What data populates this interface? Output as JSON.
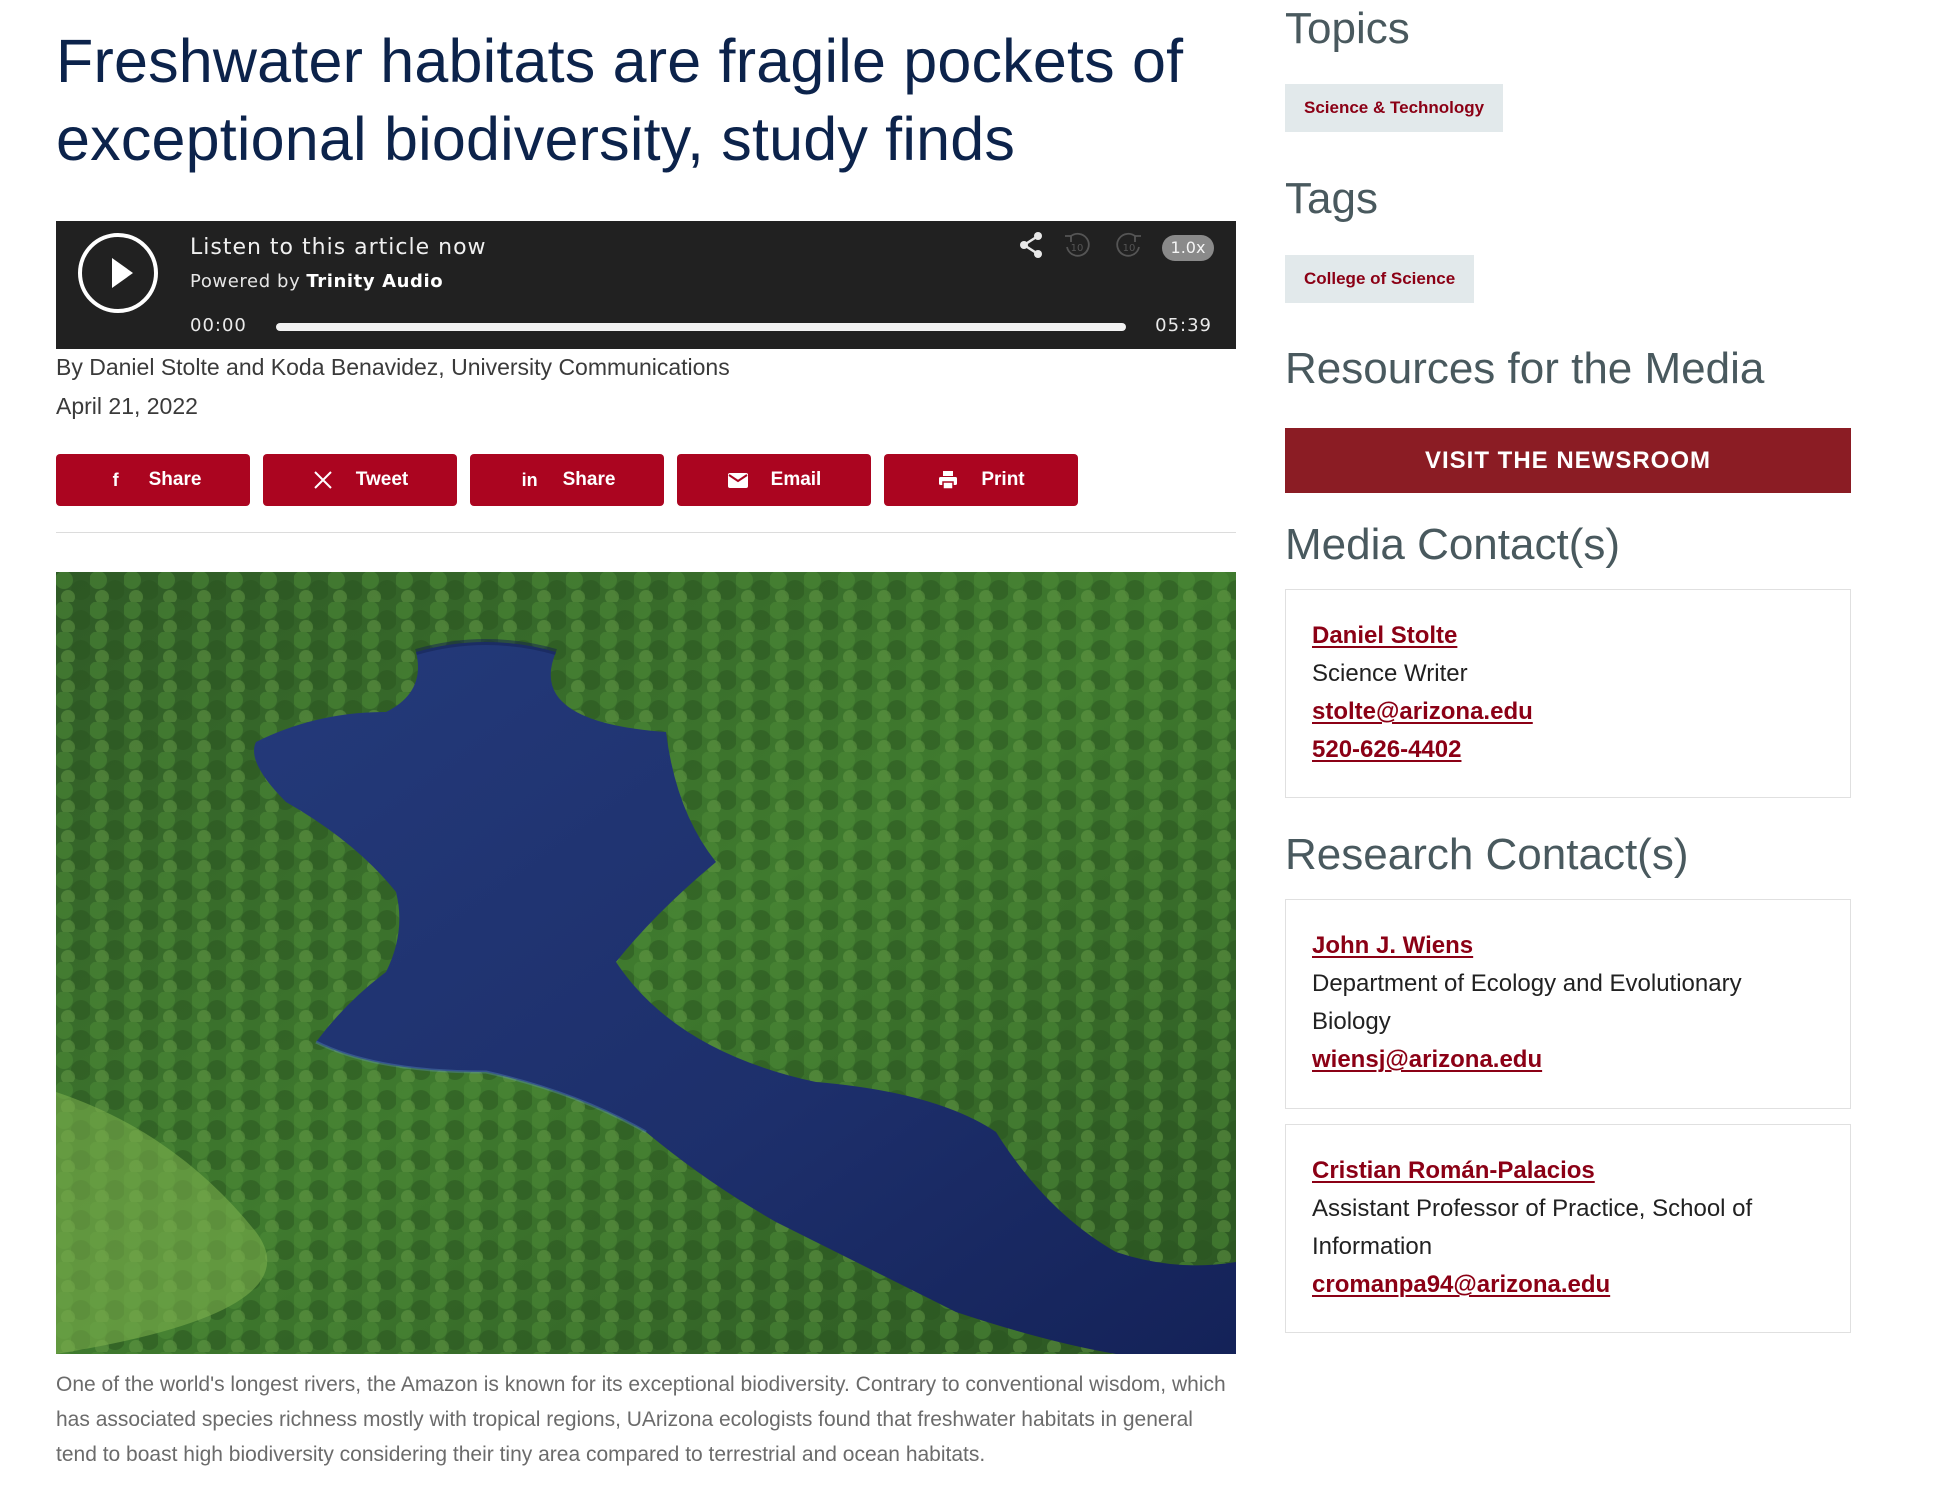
{
  "article": {
    "headline": "Freshwater habitats are fragile pockets of exceptional biodiversity, study finds",
    "byline": "By Daniel Stolte and Koda Benavidez, University Communications",
    "date": "April 21, 2022",
    "caption": "One of the world's longest rivers, the Amazon is known for its exceptional biodiversity. Contrary to conventional wisdom, which has associated species richness mostly with tropical regions, UArizona ecologists found that freshwater habitats in general tend to boast high biodiversity considering their tiny area compared to terrestrial and ocean habitats."
  },
  "audio_player": {
    "listen_text": "Listen to this article now",
    "powered_by_label": "Powered by",
    "powered_by_brand": "Trinity Audio",
    "current_time": "00:00",
    "duration": "05:39",
    "speed": "1.0x",
    "rewind_label": "10",
    "forward_label": "10",
    "progress": 0.0
  },
  "share_buttons": [
    {
      "label": "Share",
      "icon": "facebook-icon"
    },
    {
      "label": "Tweet",
      "icon": "x-twitter-icon"
    },
    {
      "label": "Share",
      "icon": "linkedin-icon"
    },
    {
      "label": "Email",
      "icon": "email-icon"
    },
    {
      "label": "Print",
      "icon": "print-icon"
    }
  ],
  "sidebar": {
    "topics_heading": "Topics",
    "topics": [
      "Science & Technology"
    ],
    "tags_heading": "Tags",
    "tags": [
      "College of Science"
    ],
    "resources_heading": "Resources for the Media",
    "newsroom_button": "VISIT THE NEWSROOM",
    "media_contacts_heading": "Media Contact(s)",
    "media_contacts": [
      {
        "name": "Daniel Stolte",
        "title": "Science Writer",
        "email": "stolte@arizona.edu",
        "phone": "520-626-4402"
      }
    ],
    "research_contacts_heading": "Research Contact(s)",
    "research_contacts": [
      {
        "name": "John J. Wiens",
        "title_line1": "Department of Ecology and Evolutionary",
        "title_line2": "Biology",
        "email": "wiensj@arizona.edu"
      },
      {
        "name": "Cristian Román-Palacios",
        "title_line1": "Assistant Professor of Practice, School of",
        "title_line2": "Information",
        "email": "cromanpa94@arizona.edu"
      }
    ]
  },
  "colors": {
    "headline": "#0c234b",
    "accent_red": "#ab0520",
    "newsroom_red": "#8b1c24",
    "link_red": "#8b0015",
    "sidebar_heading": "#49595e",
    "pill_bg": "#e2e9eb",
    "player_bg": "#212121"
  }
}
